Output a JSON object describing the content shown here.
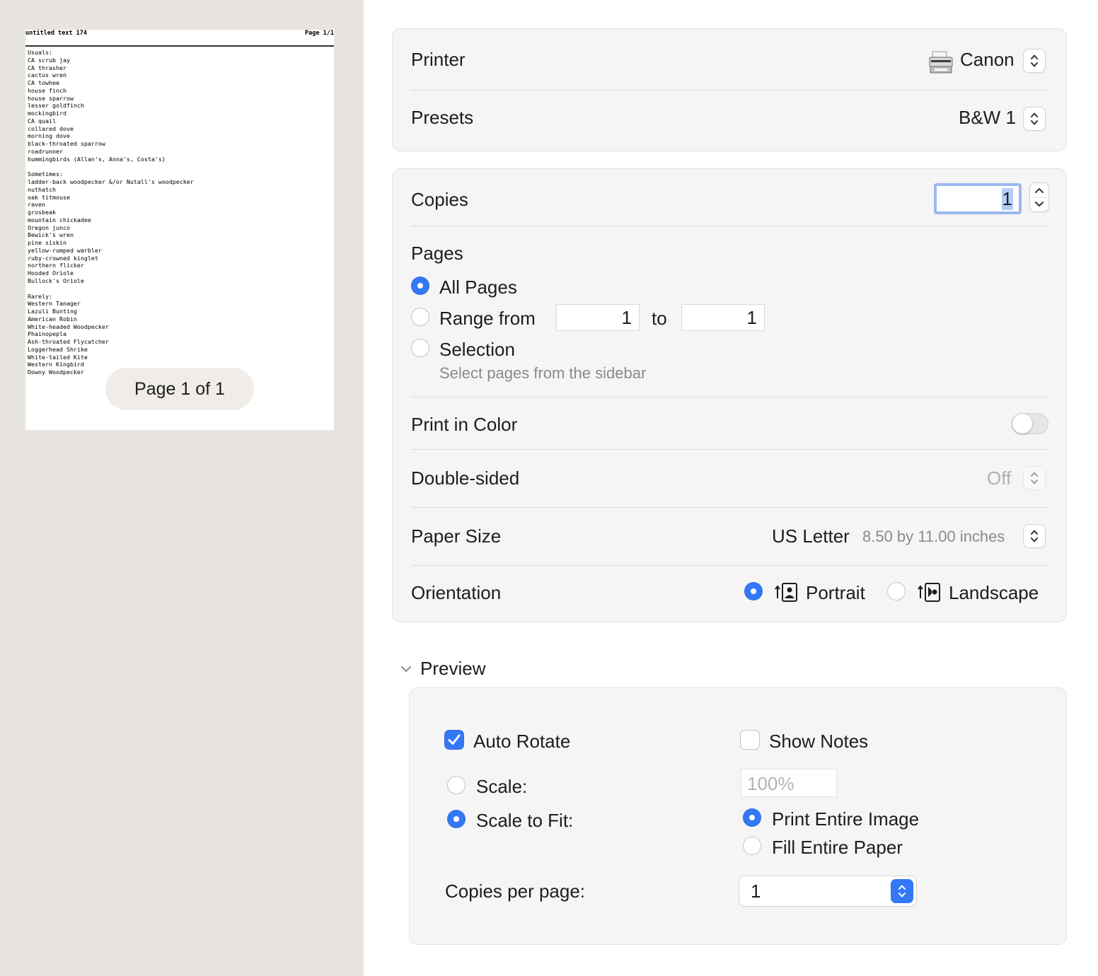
{
  "preview": {
    "doc_title": "untitled text 174",
    "page_label": "Page 1/1",
    "lines": [
      "Usuals:",
      "CA scrub jay",
      "CA thrasher",
      "cactus wren",
      "CA towhee",
      "house finch",
      "house sparrow",
      "lesser goldfinch",
      "mockingbird",
      "CA quail",
      "collared dove",
      "morning dove",
      "black-throated sparrow",
      "roadrunner",
      "hummingbirds (Allan's, Anna's, Costa's)",
      "",
      "Sometimes:",
      "ladder-back woodpecker &/or Nutall's woodpecker",
      "nuthatch",
      "oak titmouse",
      "raven",
      "grosbeak",
      "mountain chickadee",
      "Oregon junco",
      "Bewick's wren",
      "pine siskin",
      "yellow-rumped warbler",
      "ruby-crowned kinglet",
      "northern flicker",
      "Hooded Oriole",
      "Bullock's Oriole",
      "",
      "Rarely:",
      "Western Tanager",
      "Lazuli Bunting",
      "American Robin",
      "White-headed Woodpecker",
      "Phainopepla",
      "Ash-throated Flycatcher",
      "Loggerhead Shrike",
      "White-tailed Kite",
      "Western Kingbird",
      "Downy Woodpecker"
    ],
    "page_indicator": "Page 1 of 1"
  },
  "printer": {
    "label": "Printer",
    "value": "Canon",
    "icon": "printer-icon"
  },
  "presets": {
    "label": "Presets",
    "value": "B&W 1"
  },
  "copies": {
    "label": "Copies",
    "value": "1"
  },
  "pages": {
    "label": "Pages",
    "all_label": "All Pages",
    "range_label": "Range from",
    "range_from": "1",
    "to_label": "to",
    "range_to": "1",
    "selection_label": "Selection",
    "selection_hint": "Select pages from the sidebar",
    "selected": "all"
  },
  "color": {
    "label": "Print in Color",
    "on": false
  },
  "double_sided": {
    "label": "Double-sided",
    "value": "Off"
  },
  "paper_size": {
    "label": "Paper Size",
    "value": "US Letter",
    "dimensions": "8.50 by 11.00 inches"
  },
  "orientation": {
    "label": "Orientation",
    "portrait_label": "Portrait",
    "landscape_label": "Landscape",
    "selected": "portrait"
  },
  "preview_section": {
    "header": "Preview",
    "auto_rotate_label": "Auto Rotate",
    "auto_rotate": true,
    "show_notes_label": "Show Notes",
    "show_notes": false,
    "scale_label": "Scale:",
    "scale_value": "100%",
    "scale_to_fit_label": "Scale to Fit:",
    "scale_mode": "scale_to_fit",
    "print_entire_image_label": "Print Entire Image",
    "fill_entire_paper_label": "Fill Entire Paper",
    "fit_mode": "print_entire_image",
    "copies_per_page_label": "Copies per page:",
    "copies_per_page": "1"
  },
  "colors": {
    "accent": "#3478f6",
    "sidebar_bg": "#e8e4e0",
    "group_bg": "#f5f5f5"
  }
}
